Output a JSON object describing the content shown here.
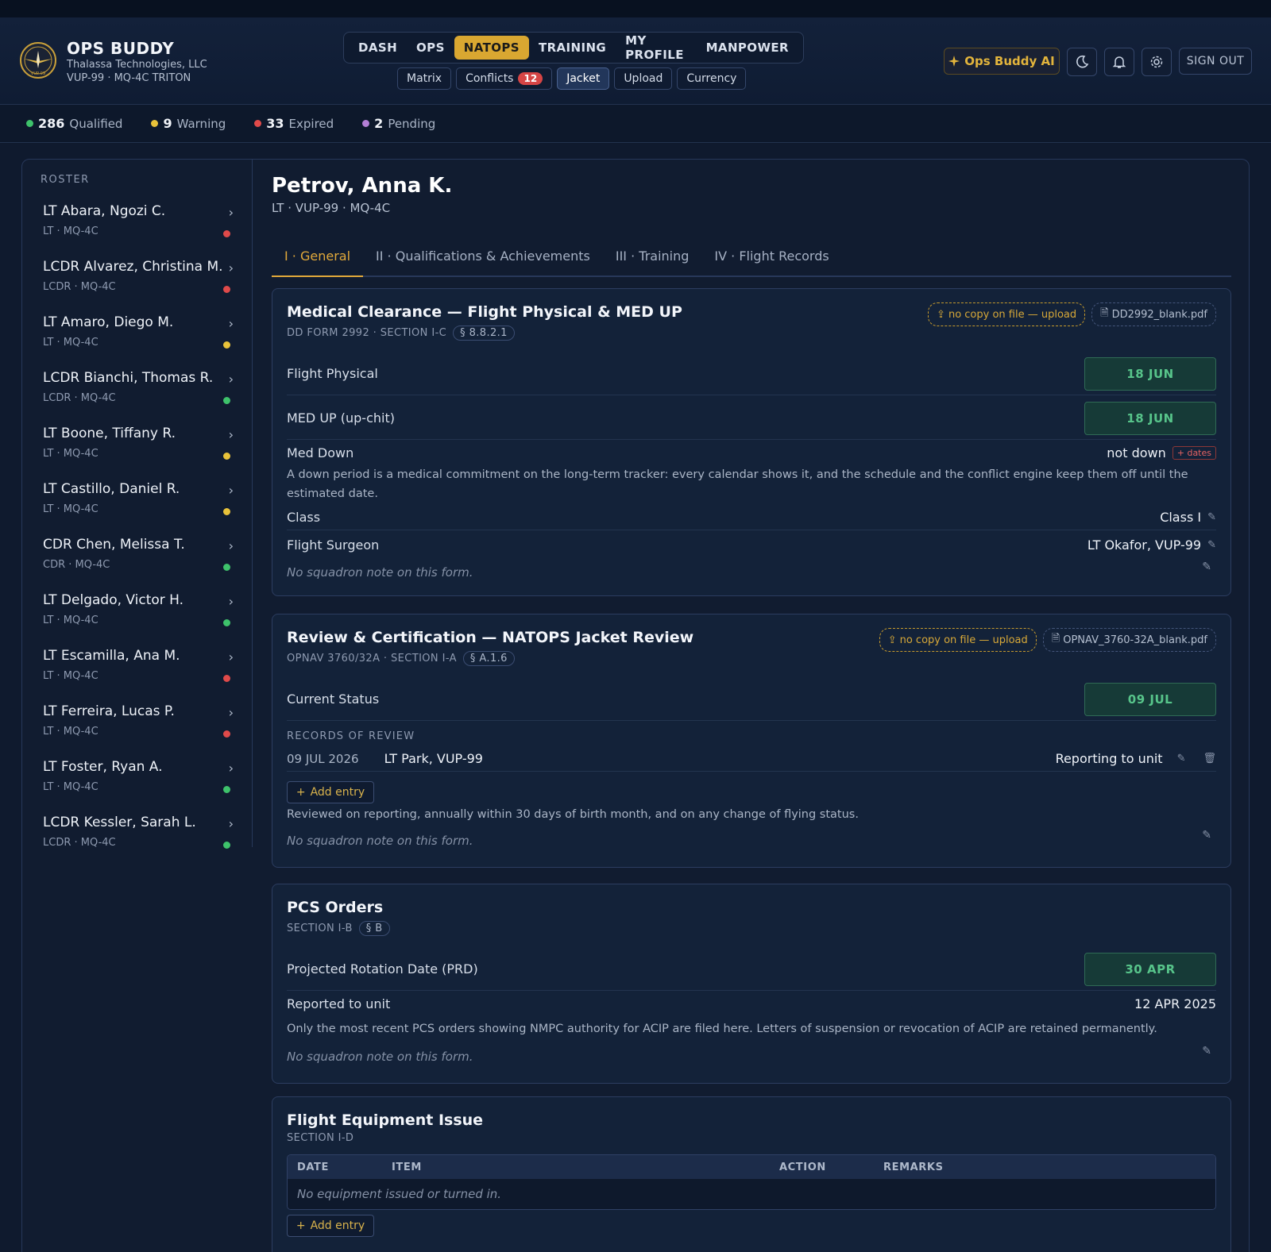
{
  "app": {
    "name": "OPS BUDDY",
    "company": "Thalassa Technologies, LLC",
    "unit": "VUP-99 · MQ-4C TRITON",
    "logo_text": "VUP-99"
  },
  "nav": {
    "items": [
      "DASH",
      "OPS",
      "NATOPS",
      "TRAINING",
      "MY PROFILE",
      "MANPOWER"
    ],
    "active": "NATOPS"
  },
  "subnav": {
    "matrix": "Matrix",
    "conflicts": "Conflicts",
    "conflicts_count": "12",
    "jacket": "Jacket",
    "upload": "Upload",
    "currency": "Currency"
  },
  "header_actions": {
    "ai_label": "Ops Buddy AI",
    "signout": "SIGN OUT",
    "icons": [
      "moon-icon",
      "bell-icon",
      "gear-icon"
    ]
  },
  "stats": {
    "qualified_count": "286",
    "qualified_label": "Qualified",
    "warning_count": "9",
    "warning_label": "Warning",
    "expired_count": "33",
    "expired_label": "Expired",
    "pending_count": "2",
    "pending_label": "Pending"
  },
  "roster": {
    "label": "ROSTER",
    "items": [
      {
        "name": "LT Abara, Ngozi C.",
        "sub": "LT · MQ-4C",
        "status": "red"
      },
      {
        "name": "LCDR Alvarez, Christina M.",
        "sub": "LCDR · MQ-4C",
        "status": "red"
      },
      {
        "name": "LT Amaro, Diego M.",
        "sub": "LT · MQ-4C",
        "status": "yellow"
      },
      {
        "name": "LCDR Bianchi, Thomas R.",
        "sub": "LCDR · MQ-4C",
        "status": "green"
      },
      {
        "name": "LT Boone, Tiffany R.",
        "sub": "LT · MQ-4C",
        "status": "yellow"
      },
      {
        "name": "LT Castillo, Daniel R.",
        "sub": "LT · MQ-4C",
        "status": "yellow"
      },
      {
        "name": "CDR Chen, Melissa T.",
        "sub": "CDR · MQ-4C",
        "status": "green"
      },
      {
        "name": "LT Delgado, Victor H.",
        "sub": "LT · MQ-4C",
        "status": "green"
      },
      {
        "name": "LT Escamilla, Ana M.",
        "sub": "LT · MQ-4C",
        "status": "red"
      },
      {
        "name": "LT Ferreira, Lucas P.",
        "sub": "LT · MQ-4C",
        "status": "red"
      },
      {
        "name": "LT Foster, Ryan A.",
        "sub": "LT · MQ-4C",
        "status": "green"
      },
      {
        "name": "LCDR Kessler, Sarah L.",
        "sub": "LCDR · MQ-4C",
        "status": "green"
      }
    ]
  },
  "person": {
    "name": "Petrov, Anna K.",
    "sub": "LT · VUP-99 · MQ-4C"
  },
  "tabs": [
    "I · General",
    "II · Qualifications & Achievements",
    "III · Training",
    "IV · Flight Records"
  ],
  "medical": {
    "title": "Medical Clearance — Flight Physical & MED UP",
    "form": "DD FORM 2992 · SECTION I-C",
    "section": "§ 8.8.2.1",
    "upload": "no copy on file — upload",
    "file": "DD2992_blank.pdf",
    "flight_physical_label": "Flight Physical",
    "flight_physical_date": "18 JUN",
    "med_up_label": "MED UP (up-chit)",
    "med_up_date": "18 JUN",
    "med_down_label": "Med Down",
    "med_down_value": "not down",
    "med_down_tag": "+ dates",
    "desc": "A down period is a medical commitment on the long-term tracker: every calendar shows it, and the schedule and the conflict engine keep them off until the estimated date.",
    "class_label": "Class",
    "class_value": "Class I",
    "surgeon_label": "Flight Surgeon",
    "surgeon_value": "LT Okafor, VUP-99",
    "note": "No squadron note on this form."
  },
  "review": {
    "title": "Review & Certification — NATOPS Jacket Review",
    "form": "OPNAV 3760/32A · SECTION I-A",
    "section": "§ A.1.6",
    "upload": "no copy on file — upload",
    "file": "OPNAV_3760-32A_blank.pdf",
    "status_label": "Current Status",
    "status_date": "09 JUL",
    "records_label": "RECORDS OF REVIEW",
    "record_date": "09 JUL 2026",
    "record_by": "LT Park, VUP-99",
    "record_reason": "Reporting to unit",
    "add_entry": "Add entry",
    "desc": "Reviewed on reporting, annually within 30 days of birth month, and on any change of flying status.",
    "note": "No squadron note on this form."
  },
  "pcs": {
    "title": "PCS Orders",
    "form": "SECTION I-B",
    "section": "§ B",
    "prd_label": "Projected Rotation Date (PRD)",
    "prd_date": "30 APR",
    "reported_label": "Reported to unit",
    "reported_value": "12 APR 2025",
    "desc": "Only the most recent PCS orders showing NMPC authority for ACIP are filed here. Letters of suspension or revocation of ACIP are retained permanently.",
    "note": "No squadron note on this form."
  },
  "equipment": {
    "title": "Flight Equipment Issue",
    "form": "SECTION I-D",
    "columns": [
      "DATE",
      "ITEM",
      "ACTION",
      "REMARKS"
    ],
    "empty": "No equipment issued or turned in.",
    "add_entry": "Add entry"
  }
}
